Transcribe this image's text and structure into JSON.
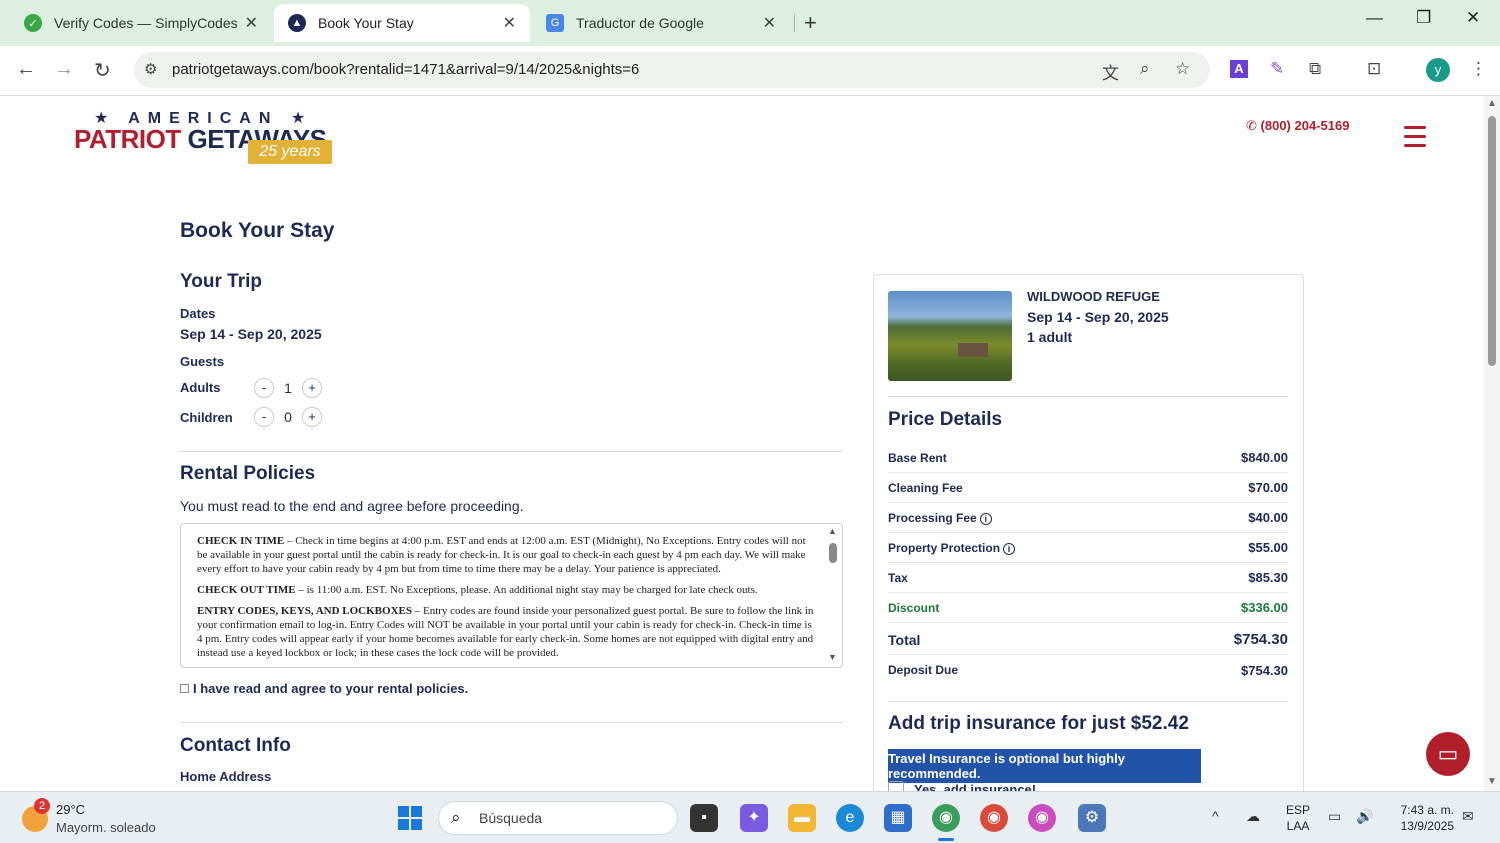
{
  "browser": {
    "tabs": [
      {
        "label": "Verify Codes — SimplyCodes",
        "favicon": "simplycodes-icon"
      },
      {
        "label": "Book Your Stay",
        "favicon": "patriot-getaways-icon"
      },
      {
        "label": "Traductor de Google",
        "favicon": "google-translate-icon"
      }
    ],
    "url": "patriotgetaways.com/book?rentalid=1471&arrival=9/14/2025&nights=6",
    "profile_initial": "y"
  },
  "site": {
    "logo_top": "★ AMERICAN ★",
    "logo_word1": "PATRIOT",
    "logo_word2": "GETAWAYS",
    "logo_badge": "25 years",
    "phone": "(800) 204-5169"
  },
  "page": {
    "title": "Book Your Stay",
    "trip_heading": "Your Trip",
    "dates_label": "Dates",
    "dates_value": "Sep 14 - Sep 20, 2025",
    "guests_label": "Guests",
    "adults_label": "Adults",
    "adults_value": "1",
    "children_label": "Children",
    "children_value": "0",
    "policies_heading": "Rental Policies",
    "policies_note": "You must read to the end and agree before proceeding.",
    "policy_checkin_title": "CHECK IN TIME",
    "policy_checkin_text": " – Check in time begins at 4:00 p.m. EST and ends at 12:00 a.m. EST (Midnight), No Exceptions.  Entry codes will not be available in your guest portal until the cabin is ready for check-in.  It is our goal to check-in each guest by 4 pm each day.  We will make every effort to have your cabin ready by 4 pm but from time to time there may be a delay.  Your patience is appreciated.",
    "policy_checkout_title": "CHECK OUT TIME",
    "policy_checkout_text": " – is 11:00 a.m. EST. No Exceptions, please. An additional night stay may be charged for late check outs.",
    "policy_entry_title": "ENTRY CODES, KEYS, AND LOCKBOXES",
    "policy_entry_text": " – Entry codes are found inside your personalized guest portal.  Be sure to follow the link in your confirmation email to log-in.  Entry Codes will NOT be available in your portal until your cabin is ready for check-in.  Check-in time is 4 pm.  Entry codes will appear early if your home becomes available for early check-in.  Some homes are not equipped with digital entry and instead use a keyed lockbox or lock; in these cases the lock code will be provided.",
    "agree_label": "I have read and agree to your rental policies.",
    "contact_heading": "Contact Info",
    "home_address_label": "Home Address"
  },
  "summary": {
    "property_name": "WILDWOOD REFUGE",
    "dates": "Sep 14 - Sep 20, 2025",
    "guests": "1 adult",
    "price_heading": "Price Details",
    "rows": [
      {
        "label": "Base Rent",
        "amount": "$840.00",
        "info": false
      },
      {
        "label": "Cleaning Fee",
        "amount": "$70.00",
        "info": false
      },
      {
        "label": "Processing Fee",
        "amount": "$40.00",
        "info": true
      },
      {
        "label": "Property Protection",
        "amount": "$55.00",
        "info": true
      },
      {
        "label": "Tax",
        "amount": "$85.30",
        "info": false
      },
      {
        "label": "Discount",
        "amount": "$336.00",
        "info": false
      },
      {
        "label": "Total",
        "amount": "$754.30",
        "info": false
      },
      {
        "label": "Deposit Due",
        "amount": "$754.30",
        "info": false
      }
    ],
    "insurance_heading": "Add trip insurance for just $52.42",
    "insurance_note": "Travel Insurance is optional but highly recommended.",
    "insurance_option": "Yes, add insurance!"
  },
  "taskbar": {
    "weather_badge": "2",
    "weather_temp": "29°C",
    "weather_desc": "Mayorm. soleado",
    "search_placeholder": "Búsqueda",
    "lang_top": "ESP",
    "lang_bottom": "LAA",
    "time": "7:43 a. m.",
    "date": "13/9/2025"
  }
}
